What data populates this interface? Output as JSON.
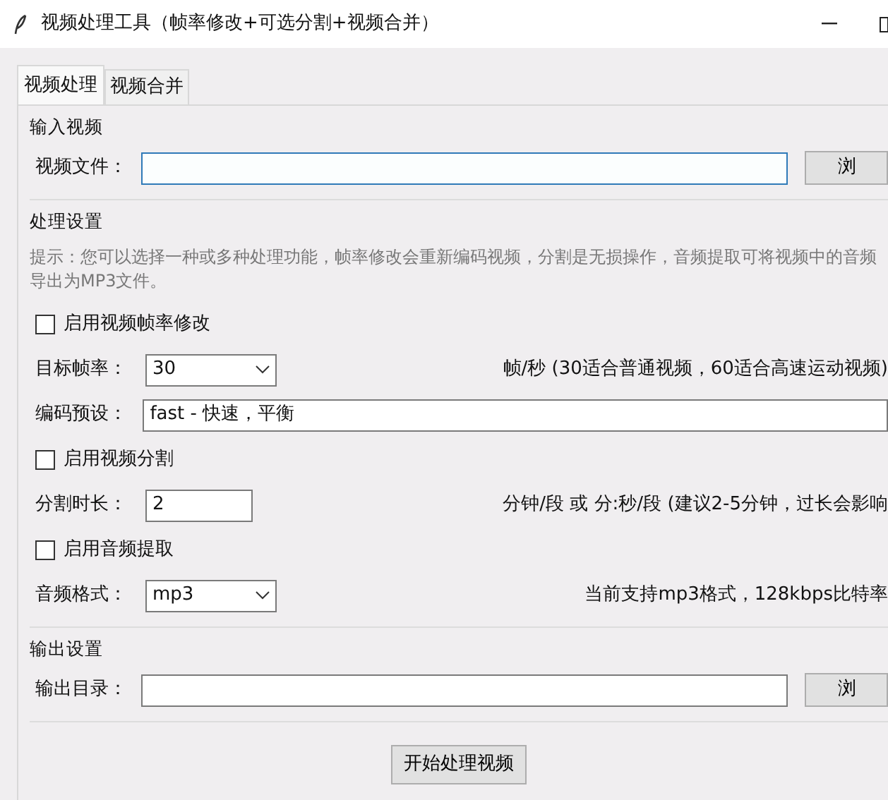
{
  "window": {
    "title": "视频处理工具（帧率修改+可选分割+视频合并）"
  },
  "tabs": [
    {
      "label": "视频处理",
      "selected": true
    },
    {
      "label": "视频合并",
      "selected": false
    }
  ],
  "sections": [
    {
      "title": "输入视频",
      "rows": [
        {
          "kind": "file",
          "label": "视频文件：",
          "focused": true,
          "button": "浏"
        }
      ]
    },
    {
      "title": "处理设置",
      "rows": [
        {
          "kind": "hint",
          "text": "提示：您可以选择一种或多种处理功能，帧率修改会重新编码视频，分割是无损操作，音频提取可将视频中的音频导出为MP3文件。"
        },
        {
          "kind": "check",
          "label": "启用视频帧率修改",
          "checked": false
        },
        {
          "kind": "select",
          "label": "目标帧率：",
          "value": "30",
          "note": "帧/秒 (30适合普通视频，60适合高速运动视频)"
        },
        {
          "kind": "text",
          "label": "编码预设：",
          "value": "fast - 快速，平衡"
        },
        {
          "kind": "check",
          "label": "启用视频分割",
          "checked": false
        },
        {
          "kind": "text",
          "label": "分割时长：",
          "value": "2",
          "note": "分钟/段 或 分:秒/段 (建议2-5分钟，过长会影响"
        },
        {
          "kind": "check",
          "label": "启用音频提取",
          "checked": false
        },
        {
          "kind": "select",
          "label": "音频格式：",
          "value": "mp3",
          "note": "当前支持mp3格式，128kbps比特率"
        }
      ]
    },
    {
      "title": "输出设置",
      "rows": [
        {
          "kind": "file",
          "label": "输出目录：",
          "focused": false,
          "button": "浏"
        }
      ]
    }
  ],
  "action_button": "开始处理视频"
}
